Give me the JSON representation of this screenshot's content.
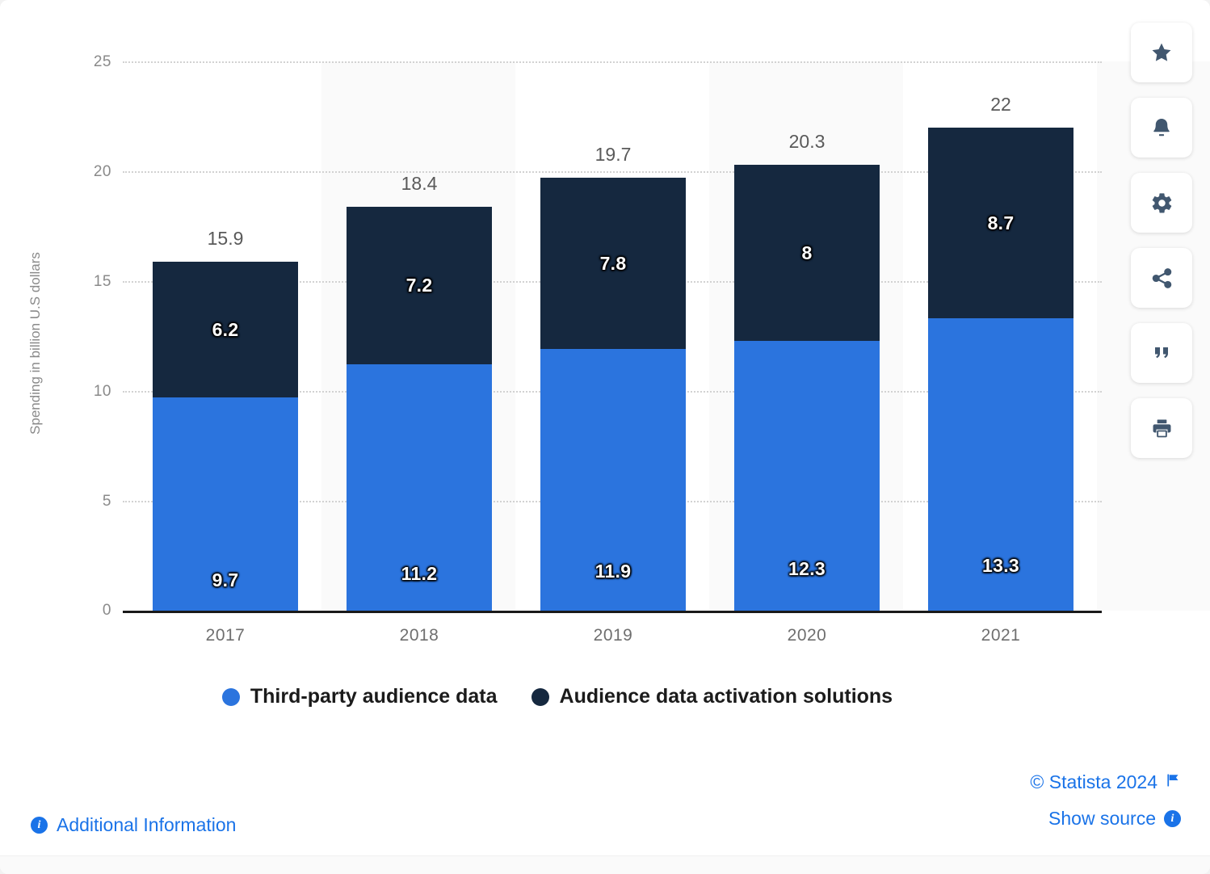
{
  "chart_data": {
    "type": "bar",
    "subtype": "stacked-column",
    "title": "",
    "xlabel": "",
    "ylabel": "Spending in billion U.S dollars",
    "categories": [
      "2017",
      "2018",
      "2019",
      "2020",
      "2021"
    ],
    "ylim": [
      0,
      25
    ],
    "yticks": [
      "0",
      "5",
      "10",
      "15",
      "20",
      "25"
    ],
    "grid": true,
    "legend_position": "bottom",
    "series": [
      {
        "name": "Third-party audience data",
        "color": "#2b74de",
        "values": [
          9.7,
          11.2,
          11.9,
          12.3,
          13.3
        ],
        "labels": [
          "9.7",
          "11.2",
          "11.9",
          "12.3",
          "13.3"
        ]
      },
      {
        "name": "Audience data activation solutions",
        "color": "#15283f",
        "values": [
          6.2,
          7.2,
          7.8,
          8,
          8.7
        ],
        "labels": [
          "6.2",
          "7.2",
          "7.8",
          "8",
          "8.7"
        ]
      }
    ],
    "totals": [
      15.9,
      18.4,
      19.7,
      20.3,
      22
    ],
    "total_labels": [
      "15.9",
      "18.4",
      "19.7",
      "20.3",
      "22"
    ]
  },
  "toolbar": {
    "items": [
      {
        "icon": "star-icon",
        "name": "favorite-button"
      },
      {
        "icon": "bell-icon",
        "name": "notification-button"
      },
      {
        "icon": "gear-icon",
        "name": "settings-button"
      },
      {
        "icon": "share-icon",
        "name": "share-button"
      },
      {
        "icon": "quote-icon",
        "name": "cite-button"
      },
      {
        "icon": "printer-icon",
        "name": "print-button"
      }
    ]
  },
  "footer": {
    "additional_information": "Additional Information",
    "copyright": "© Statista 2024",
    "show_source": "Show source",
    "info_glyph": "i",
    "flag_icon": "flag-icon"
  },
  "colors": {
    "series_primary": "#2b74de",
    "series_secondary": "#15283f",
    "link": "#1a73e8",
    "grid": "#d2d2d2",
    "band": "#fafafa",
    "axis": "#1a1a1a",
    "tick_text": "#8a8a8a"
  }
}
